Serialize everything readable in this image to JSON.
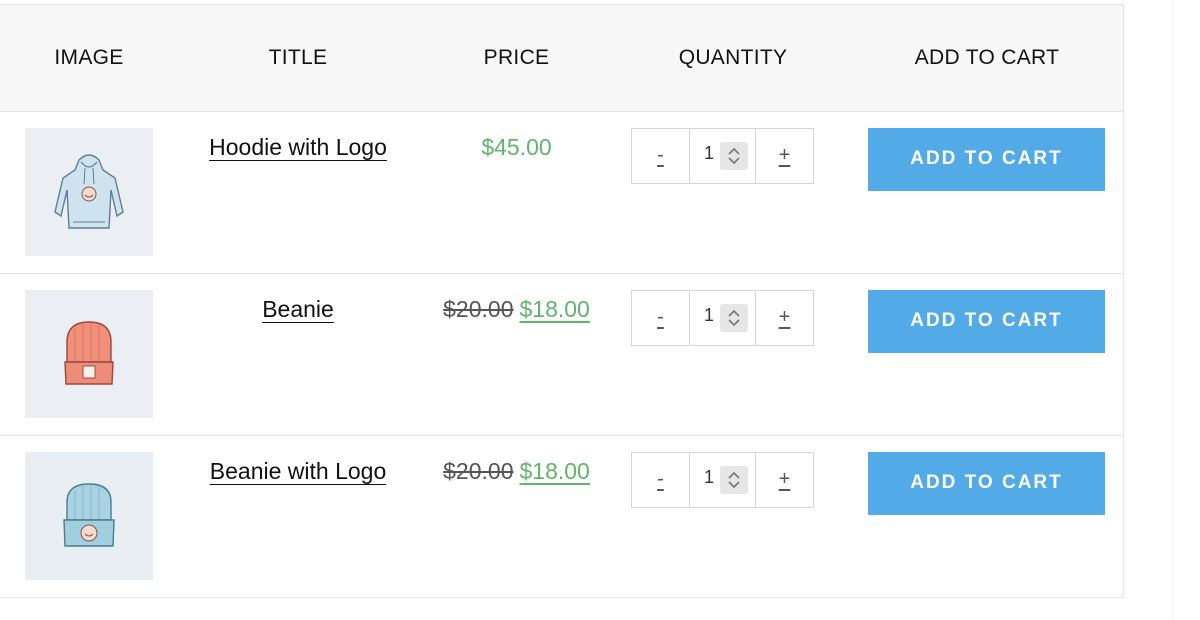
{
  "table": {
    "headers": {
      "image": "IMAGE",
      "title": "TITLE",
      "price": "PRICE",
      "quantity": "QUANTITY",
      "add_to_cart": "ADD TO CART"
    },
    "rows": [
      {
        "title": "Hoodie with Logo",
        "price": "$45.00",
        "old_price": null,
        "sale_price": null,
        "quantity": "1",
        "minus_label": "-",
        "plus_label": "+",
        "cart_label": "ADD TO CART",
        "image_icon": "hoodie-icon"
      },
      {
        "title": "Beanie",
        "price": null,
        "old_price": "$20.00",
        "sale_price": "$18.00",
        "quantity": "1",
        "minus_label": "-",
        "plus_label": "+",
        "cart_label": "ADD TO CART",
        "image_icon": "beanie-icon"
      },
      {
        "title": "Beanie with Logo",
        "price": null,
        "old_price": "$20.00",
        "sale_price": "$18.00",
        "quantity": "1",
        "minus_label": "-",
        "plus_label": "+",
        "cart_label": "ADD TO CART",
        "image_icon": "beanie-logo-icon"
      }
    ]
  },
  "colors": {
    "accent_button": "#52abe6",
    "price_green": "#5fb56c",
    "header_bg": "#f7f7f7"
  }
}
